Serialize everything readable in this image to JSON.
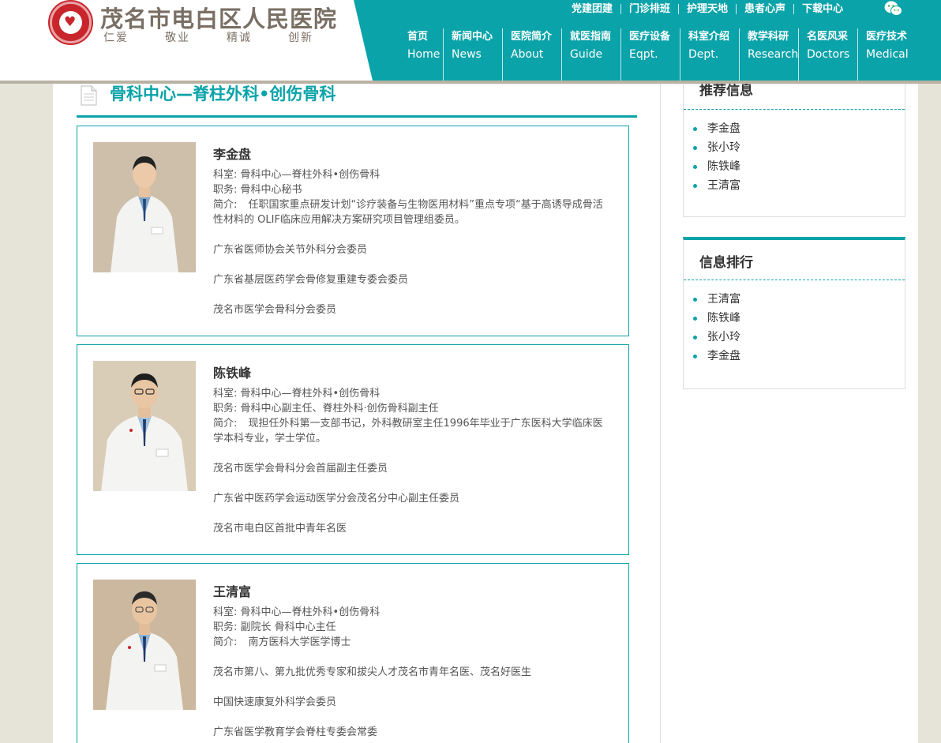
{
  "header": {
    "site_title": "茂名市电白区人民医院",
    "slogan": [
      "仁爱",
      "敬业",
      "精诚",
      "创新"
    ],
    "top_links": [
      "党建团建",
      "门诊排班",
      "护理天地",
      "患者心声",
      "下载中心"
    ],
    "nav": [
      {
        "cn": "首页",
        "en": "Home"
      },
      {
        "cn": "新闻中心",
        "en": "News"
      },
      {
        "cn": "医院简介",
        "en": "About"
      },
      {
        "cn": "就医指南",
        "en": "Guide"
      },
      {
        "cn": "医疗设备",
        "en": "Eqpt."
      },
      {
        "cn": "科室介绍",
        "en": "Dept."
      },
      {
        "cn": "教学科研",
        "en": "Research"
      },
      {
        "cn": "名医风采",
        "en": "Doctors"
      },
      {
        "cn": "医疗技术",
        "en": "Medical"
      }
    ],
    "colors": {
      "teal": "#0aa3a9",
      "brand_red": "#c8252c",
      "title_gray": "#7a6f64"
    }
  },
  "main": {
    "section_title": "骨科中心—脊柱外科•创伤骨科",
    "doctors": [
      {
        "name": "李金盘",
        "dept_label": "科室:",
        "dept": "骨科中心—脊柱外科•创伤骨科",
        "title_label": "职务:",
        "title": "骨科中心秘书",
        "bio_label": "简介:",
        "bio": "任职国家重点研发计划“诊疗装备与生物医用材料”重点专项“基于高诱导成骨活性材料的 OLIF临床应用解决方案研究项目管理组委员。",
        "extras": [
          "广东省医师协会关节外科分会委员",
          "广东省基层医药学会骨修复重建专委会委员",
          "茂名市医学会骨科分会委员"
        ]
      },
      {
        "name": "陈铁峰",
        "dept_label": "科室:",
        "dept": "骨科中心—脊柱外科•创伤骨科",
        "title_label": "职务:",
        "title": "骨科中心副主任、脊柱外科·创伤骨科副主任",
        "bio_label": "简介:",
        "bio": "现担任外科第一支部书记，外科教研室主任1996年毕业于广东医科大学临床医学本科专业，学士学位。",
        "extras": [
          "茂名市医学会骨科分会首届副主任委员",
          "广东省中医药学会运动医学分会茂名分中心副主任委员",
          "茂名市电白区首批中青年名医"
        ]
      },
      {
        "name": "王清富",
        "dept_label": "科室:",
        "dept": "骨科中心—脊柱外科•创伤骨科",
        "title_label": "职务:",
        "title": "副院长 骨科中心主任",
        "bio_label": "简介:",
        "bio": "南方医科大学医学博士",
        "extras": [
          "茂名市第八、第九批优秀专家和拔尖人才茂名市青年名医、茂名好医生",
          "中国快速康复外科学会委员",
          "广东省医学教育学会脊柱专委会常委"
        ]
      }
    ]
  },
  "sidebar": {
    "recommended": {
      "title": "推荐信息",
      "items": [
        "李金盘",
        "张小玲",
        "陈铁峰",
        "王清富"
      ]
    },
    "ranking": {
      "title": "信息排行",
      "items": [
        "王清富",
        "陈铁峰",
        "张小玲",
        "李金盘"
      ]
    }
  }
}
